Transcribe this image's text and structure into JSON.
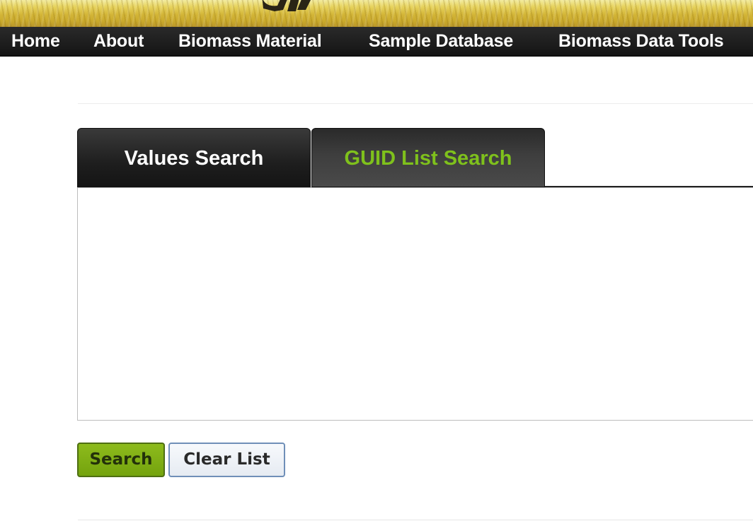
{
  "nav": {
    "items": [
      {
        "label": "Home"
      },
      {
        "label": "About"
      },
      {
        "label": "Biomass Material"
      },
      {
        "label": "Sample Database"
      },
      {
        "label": "Biomass Data Tools"
      }
    ]
  },
  "tabs": {
    "values_search": "Values Search",
    "guid_list_search": "GUID List Search",
    "active": "guid_list_search"
  },
  "guid_list": {
    "value": ""
  },
  "buttons": {
    "search": "Search",
    "clear_list": "Clear List"
  },
  "colors": {
    "active_tab_text": "#7fc11c",
    "search_button": "#7daa12",
    "nav_background": "#1a1a1a",
    "banner": "#d7bb3c"
  }
}
